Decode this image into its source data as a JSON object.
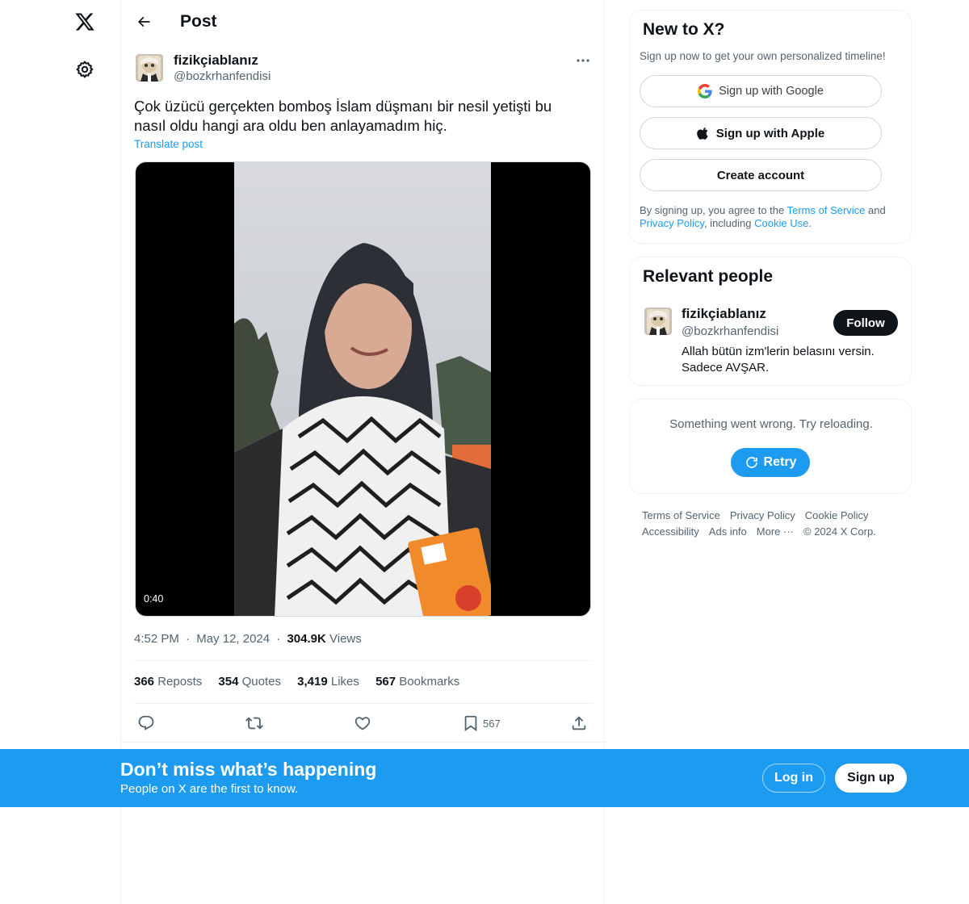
{
  "nav": {
    "logo_icon": "x-logo-icon",
    "settings_icon": "gear-icon"
  },
  "header": {
    "back_icon": "arrow-left-icon",
    "title": "Post"
  },
  "post": {
    "author_name": "fizikçiablanız",
    "author_handle": "@bozkrhanfendisi",
    "more_icon": "more-horizontal-icon",
    "text": "Çok üzücü gerçekten bomboş İslam düşmanı bir nesil yetişti bu nasıl oldu hangi ara oldu ben anlayamadım hiç.",
    "translate_label": "Translate post",
    "video_duration": "0:40",
    "time": "4:52 PM",
    "date": "May 12, 2024",
    "views_count": "304.9K",
    "views_label": "Views",
    "separator": "·",
    "stats": {
      "reposts_count": "366",
      "reposts_label": "Reposts",
      "quotes_count": "354",
      "quotes_label": "Quotes",
      "likes_count": "3,419",
      "likes_label": "Likes",
      "bookmarks_count": "567",
      "bookmarks_label": "Bookmarks"
    },
    "actions": {
      "reply_icon": "reply-icon",
      "repost_icon": "repost-icon",
      "like_icon": "heart-icon",
      "bookmark_icon": "bookmark-icon",
      "bookmark_count": "567",
      "share_icon": "share-icon"
    }
  },
  "signup_card": {
    "title": "New to X?",
    "subtitle": "Sign up now to get your own personalized timeline!",
    "google_label": "Sign up with Google",
    "apple_label": "Sign up with Apple",
    "create_label": "Create account",
    "legal_prefix": "By signing up, you agree to the ",
    "terms_link": "Terms of Service",
    "legal_and": " and ",
    "privacy_link": "Privacy Policy",
    "legal_including": ", including ",
    "cookie_link": "Cookie Use",
    "legal_end": "."
  },
  "relevant_people": {
    "title": "Relevant people",
    "name": "fizikçiablanız",
    "handle": "@bozkrhanfendisi",
    "bio": "Allah bütün izm'lerin belasını versin. Sadece AVŞAR.",
    "follow_label": "Follow"
  },
  "error_card": {
    "message": "Something went wrong. Try reloading.",
    "retry_label": "Retry"
  },
  "footer": {
    "links": [
      "Terms of Service",
      "Privacy Policy",
      "Cookie Policy",
      "Accessibility",
      "Ads info",
      "More ···",
      "© 2024 X Corp."
    ]
  },
  "banner": {
    "title": "Don’t miss what’s happening",
    "subtitle": "People on X are the first to know.",
    "login_label": "Log in",
    "signup_label": "Sign up"
  },
  "colors": {
    "accent": "#1d9bf0",
    "text_primary": "#0f1419",
    "text_secondary": "#536471",
    "border": "#eff3f4"
  }
}
